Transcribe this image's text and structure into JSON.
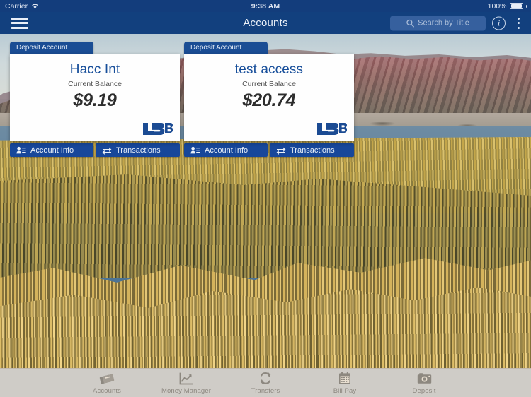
{
  "status_bar": {
    "carrier": "Carrier",
    "wifi_icon": "wifi-icon",
    "time": "9:38 AM",
    "battery_percent": "100%",
    "battery_icon": "battery-full-icon"
  },
  "nav_bar": {
    "menu_icon": "hamburger-menu-icon",
    "title": "Accounts",
    "search_placeholder": "Search by Title",
    "search_icon": "search-icon",
    "info_icon": "info-icon",
    "overflow_icon": "overflow-menu-icon"
  },
  "accounts": [
    {
      "type_label": "Deposit Account",
      "name": "Hacc Int",
      "balance_label": "Current Balance",
      "balance": "$9.19",
      "logo_text": "LSB",
      "actions": [
        {
          "label": "Account Info",
          "icon": "account-info-icon"
        },
        {
          "label": "Transactions",
          "icon": "transactions-exchange-icon"
        }
      ]
    },
    {
      "type_label": "Deposit Account",
      "name": "test access",
      "balance_label": "Current Balance",
      "balance": "$20.74",
      "logo_text": "LSB",
      "actions": [
        {
          "label": "Account Info",
          "icon": "account-info-icon"
        },
        {
          "label": "Transactions",
          "icon": "transactions-exchange-icon"
        }
      ]
    }
  ],
  "tab_bar": {
    "items": [
      {
        "label": "Accounts",
        "icon": "cards-stack-icon"
      },
      {
        "label": "Money Manager",
        "icon": "chart-trend-icon"
      },
      {
        "label": "Transfers",
        "icon": "refresh-arrows-icon"
      },
      {
        "label": "Bill Pay",
        "icon": "calendar-icon"
      },
      {
        "label": "Deposit",
        "icon": "camera-icon"
      }
    ]
  },
  "colors": {
    "nav_blue": "#12407e",
    "status_blue": "#133d7c",
    "accent_blue": "#17479a",
    "account_name_blue": "#174e9a",
    "tab_bar_beige": "#e9dfd1",
    "tab_label_gray": "#8d8880"
  }
}
